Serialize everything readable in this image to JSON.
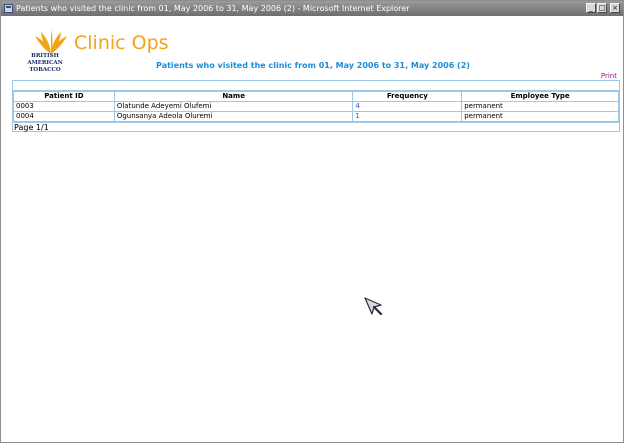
{
  "window": {
    "title": "Patients who visited the clinic from 01, May 2006 to 31, May 2006 (2) - Microsoft Internet Explorer",
    "buttons": [
      "_",
      "□",
      "×"
    ]
  },
  "logo": {
    "brand": "Clinic Ops",
    "company": "BRITISH AMERICAN TOBACCO",
    "brand_color": "#f0a519",
    "company_color": "#1b2c6b"
  },
  "report": {
    "title": "Patients who visited the clinic from 01, May 2006 to 31, May 2006 (2)",
    "title_color": "#1a8ed8",
    "print_label": "Print"
  },
  "table": {
    "columns": [
      "Patient ID",
      "Name",
      "Frequency",
      "Employee Type"
    ],
    "rows": [
      {
        "patient_id": "0003",
        "name": "Olatunde Adeyemi Olufemi",
        "frequency": "4",
        "employee_type": "permanent"
      },
      {
        "patient_id": "0004",
        "name": "Ogunsanya Adeola Oluremi",
        "frequency": "1",
        "employee_type": "permanent"
      }
    ],
    "border_color": "#9fc7e6",
    "link_color": "#1d53d8"
  },
  "pager": {
    "label": "Page 1/1"
  }
}
